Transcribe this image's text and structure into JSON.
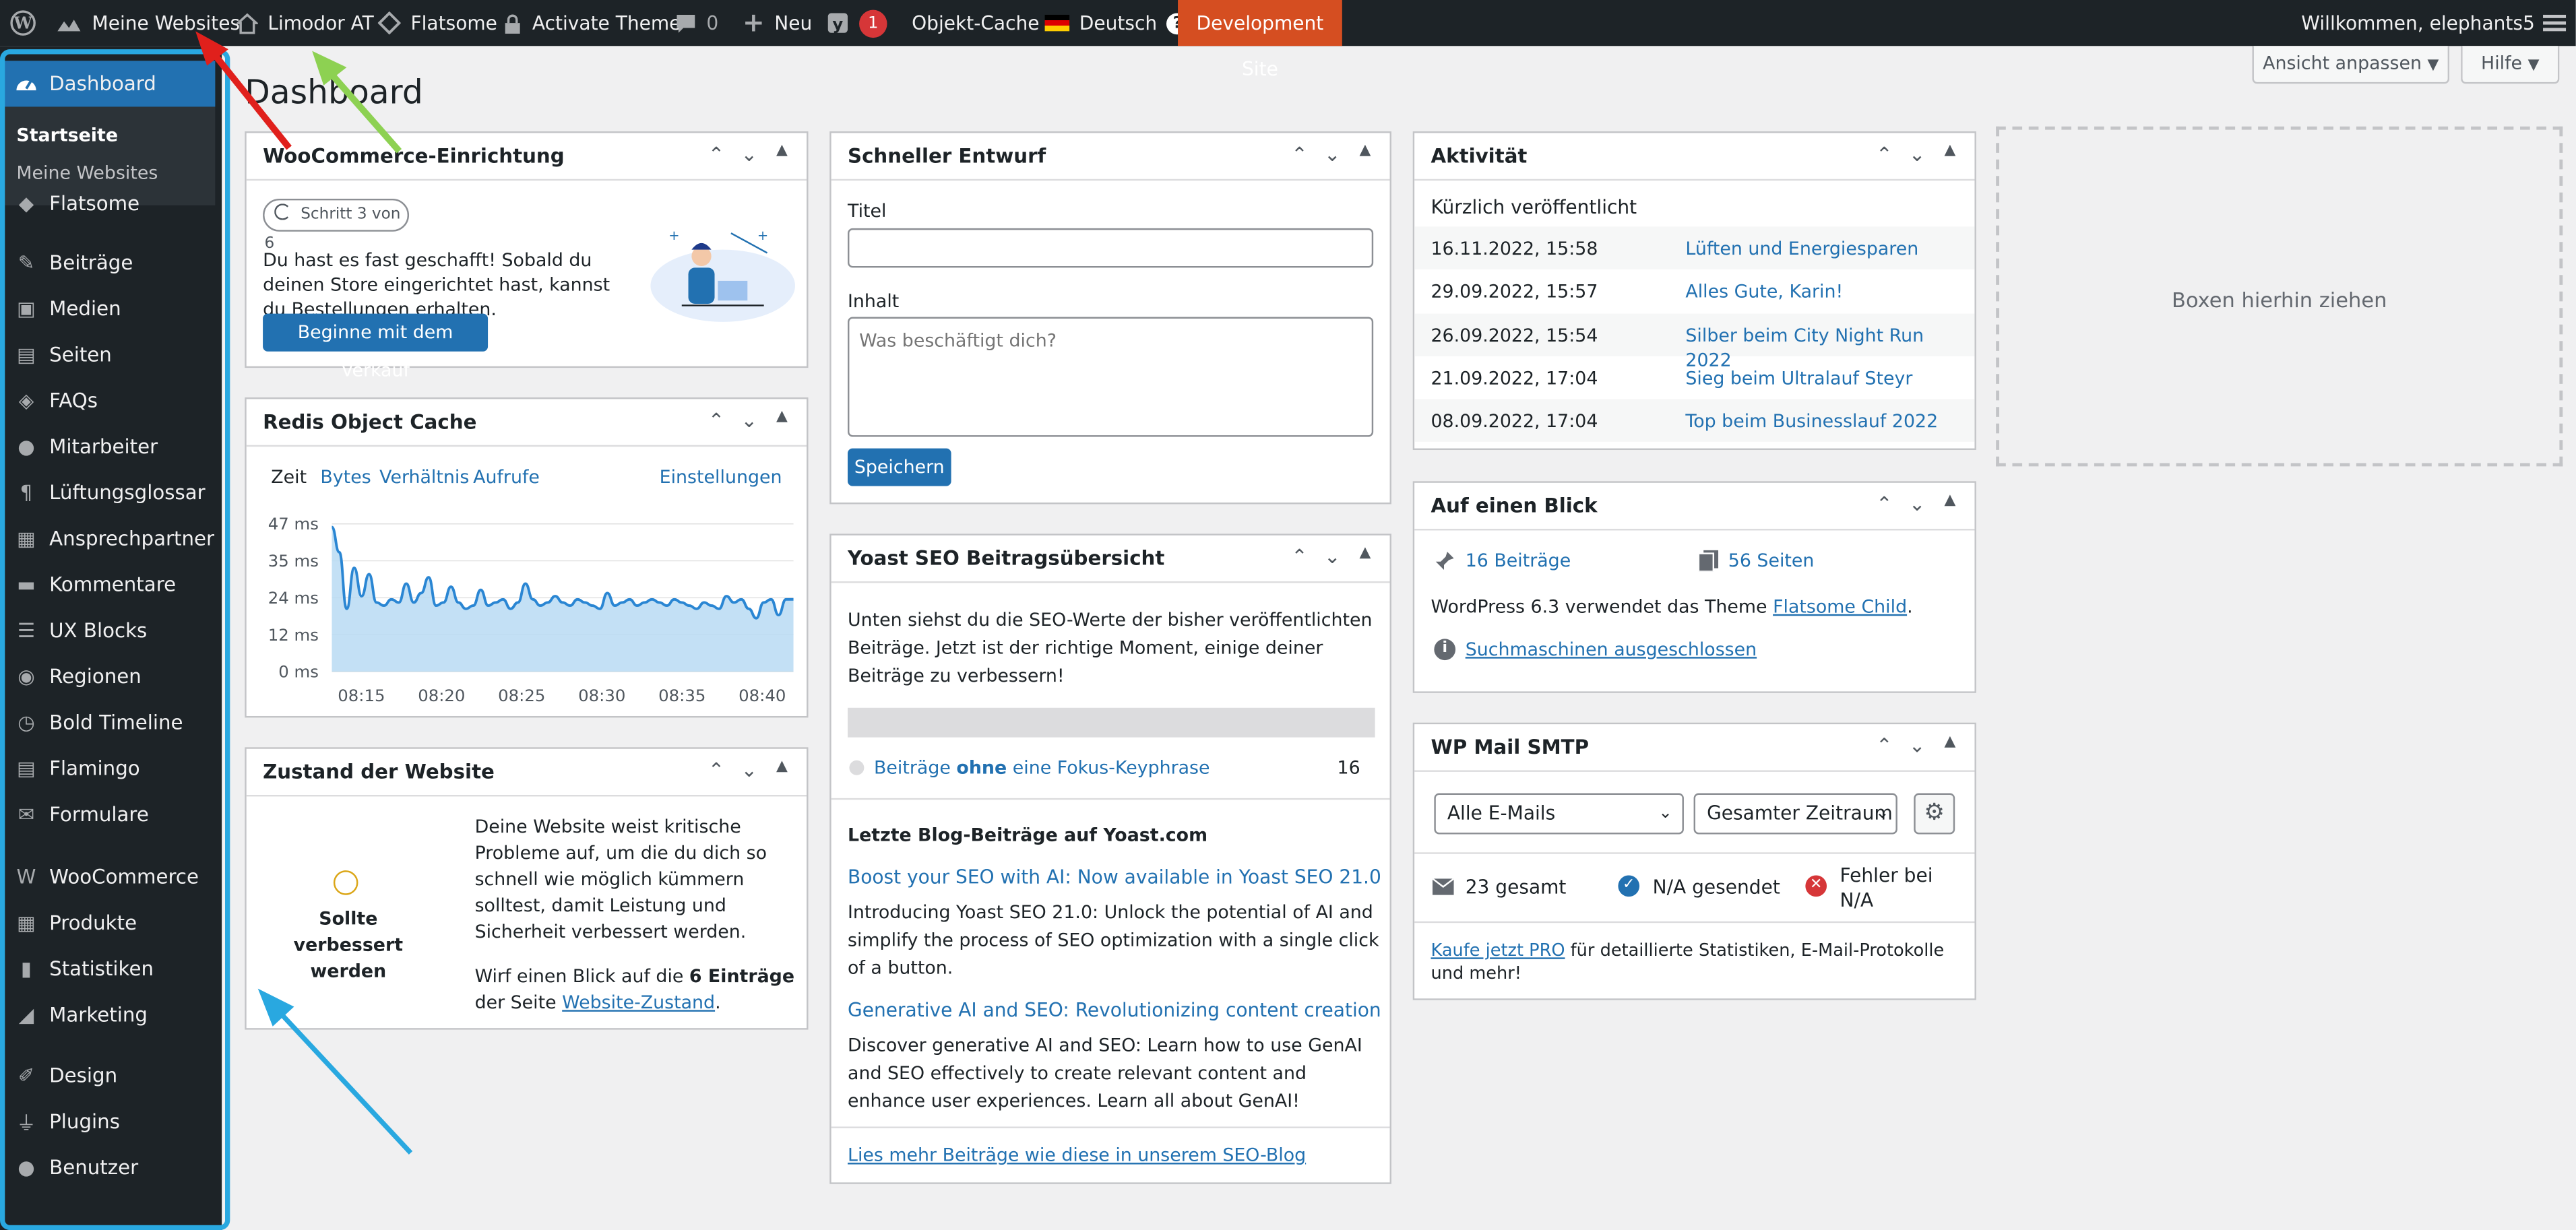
{
  "admin_bar": {
    "my_sites": "Meine Websites",
    "site_name": "Limodor AT",
    "flatsome": "Flatsome",
    "activate_theme": "Activate Theme",
    "comments": "0",
    "new": "Neu",
    "yoast_badge": "1",
    "object_cache": "Objekt-Cache",
    "language": "Deutsch",
    "dev_site": "Development Site",
    "welcome": "Willkommen, elephants5"
  },
  "page": {
    "title": "Dashboard",
    "screen_options": "Ansicht anpassen",
    "help": "Hilfe"
  },
  "sidebar": {
    "dashboard": "Dashboard",
    "sub": [
      "Startseite",
      "Meine Websites"
    ],
    "items": [
      "Flatsome",
      "Beiträge",
      "Medien",
      "Seiten",
      "FAQs",
      "Mitarbeiter",
      "Lüftungsglossar",
      "Ansprechpartner",
      "Kommentare",
      "UX Blocks",
      "Regionen",
      "Bold Timeline",
      "Flamingo",
      "Formulare",
      "WooCommerce",
      "Produkte",
      "Statistiken",
      "Marketing",
      "Design",
      "Plugins",
      "Benutzer"
    ]
  },
  "woo": {
    "title": "WooCommerce-Einrichtung",
    "step": "Schritt 3 von 6",
    "text": "Du hast es fast geschafft! Sobald du deinen Store eingerichtet hast, kannst du Bestellungen erhalten.",
    "button": "Beginne mit dem Verkauf"
  },
  "redis": {
    "title": "Redis Object Cache",
    "tabs": [
      "Zeit",
      "Bytes",
      "Verhältnis",
      "Aufrufe"
    ],
    "settings": "Einstellungen"
  },
  "chart_data": {
    "type": "area",
    "x_ticks": [
      "08:15",
      "08:20",
      "08:25",
      "08:30",
      "08:35",
      "08:40"
    ],
    "y_ticks": [
      "47 ms",
      "35 ms",
      "24 ms",
      "12 ms",
      "0 ms"
    ],
    "ylim": [
      0,
      47
    ],
    "values": [
      46,
      38,
      20,
      33,
      24,
      31,
      22,
      21,
      23,
      22,
      28,
      22,
      25,
      30,
      21,
      22,
      27,
      22,
      20,
      21,
      26,
      21,
      22,
      23,
      20,
      22,
      28,
      23,
      21,
      22,
      24,
      22,
      21,
      23,
      22,
      21,
      20,
      25,
      21,
      22,
      23,
      21,
      22,
      23,
      22,
      21,
      23,
      22,
      21,
      20,
      22,
      21,
      20,
      24,
      22,
      23,
      20,
      17,
      22,
      23,
      18,
      23,
      23
    ],
    "color": "#72aee6"
  },
  "health": {
    "title": "Zustand der Website",
    "status": "Sollte verbessert werden",
    "text1": "Deine Website weist kritische Probleme auf, um die du dich so schnell wie möglich kümmern solltest, damit Leistung und Sicherheit verbessert werden.",
    "text2_a": "Wirf einen Blick auf die ",
    "text2_b": "6 Einträge",
    "text2_c": " der Seite ",
    "link": "Website-Zustand",
    "period": "."
  },
  "draft": {
    "title": "Schneller Entwurf",
    "label_title": "Titel",
    "label_content": "Inhalt",
    "placeholder": "Was beschäftigt dich?",
    "save": "Speichern"
  },
  "yoast": {
    "title": "Yoast SEO Beitragsübersicht",
    "intro": "Unten siehst du die SEO-Werte der bisher veröffentlichten Beiträge. Jetzt ist der richtige Moment, einige deiner Beiträge zu verbessern!",
    "row_a": "Beiträge ",
    "row_b": "ohne",
    "row_c": " eine Fokus-Keyphrase",
    "row_count": "16",
    "blog_heading": "Letzte Blog-Beiträge auf Yoast.com",
    "post1_title": "Boost your SEO with AI: Now available in Yoast SEO 21.0",
    "post1_text": "Introducing Yoast SEO 21.0: Unlock the potential of AI and simplify the process of SEO optimization with a single click of a button.",
    "post2_title": "Generative AI and SEO: Revolutionizing content creation",
    "post2_text": "Discover generative AI and SEO: Learn how to use GenAI and SEO effectively to create relevant content and enhance user experiences. Learn all about GenAI!",
    "more": "Lies mehr Beiträge wie diese in unserem SEO-Blog"
  },
  "activity": {
    "title": "Aktivität",
    "subtitle": "Kürzlich veröffentlicht",
    "rows": [
      {
        "date": "16.11.2022, 15:58",
        "title": "Lüften und Energiesparen"
      },
      {
        "date": "29.09.2022, 15:57",
        "title": "Alles Gute, Karin!"
      },
      {
        "date": "26.09.2022, 15:54",
        "title": "Silber beim City Night Run 2022"
      },
      {
        "date": "21.09.2022, 17:04",
        "title": "Sieg beim Ultralauf Steyr"
      },
      {
        "date": "08.09.2022, 17:04",
        "title": "Top beim Businesslauf 2022"
      }
    ]
  },
  "glance": {
    "title": "Auf einen Blick",
    "posts": "16 Beiträge",
    "pages": "56 Seiten",
    "theme_a": "WordPress 6.3 verwendet das Theme ",
    "theme_link": "Flatsome Child",
    "theme_b": ".",
    "search": "Suchmaschinen ausgeschlossen"
  },
  "smtp": {
    "title": "WP Mail SMTP",
    "select1": "Alle E-Mails",
    "select2": "Gesamter Zeitraum",
    "total": "23 gesamt",
    "sent": "N/A gesendet",
    "errors": "Fehler bei N/A",
    "pro_link": "Kaufe jetzt PRO",
    "pro_text": " für detaillierte Statistiken, E-Mail-Protokolle und mehr!"
  },
  "dropzone": {
    "text": "Boxen hierhin ziehen"
  },
  "colors": {
    "admin_bar": "#1d2327",
    "accent": "#2271b1",
    "dev_site": "#d54e21",
    "highlight_blue": "#29a8e0",
    "arrow_red": "#e0201c",
    "arrow_green": "#8dd152"
  }
}
